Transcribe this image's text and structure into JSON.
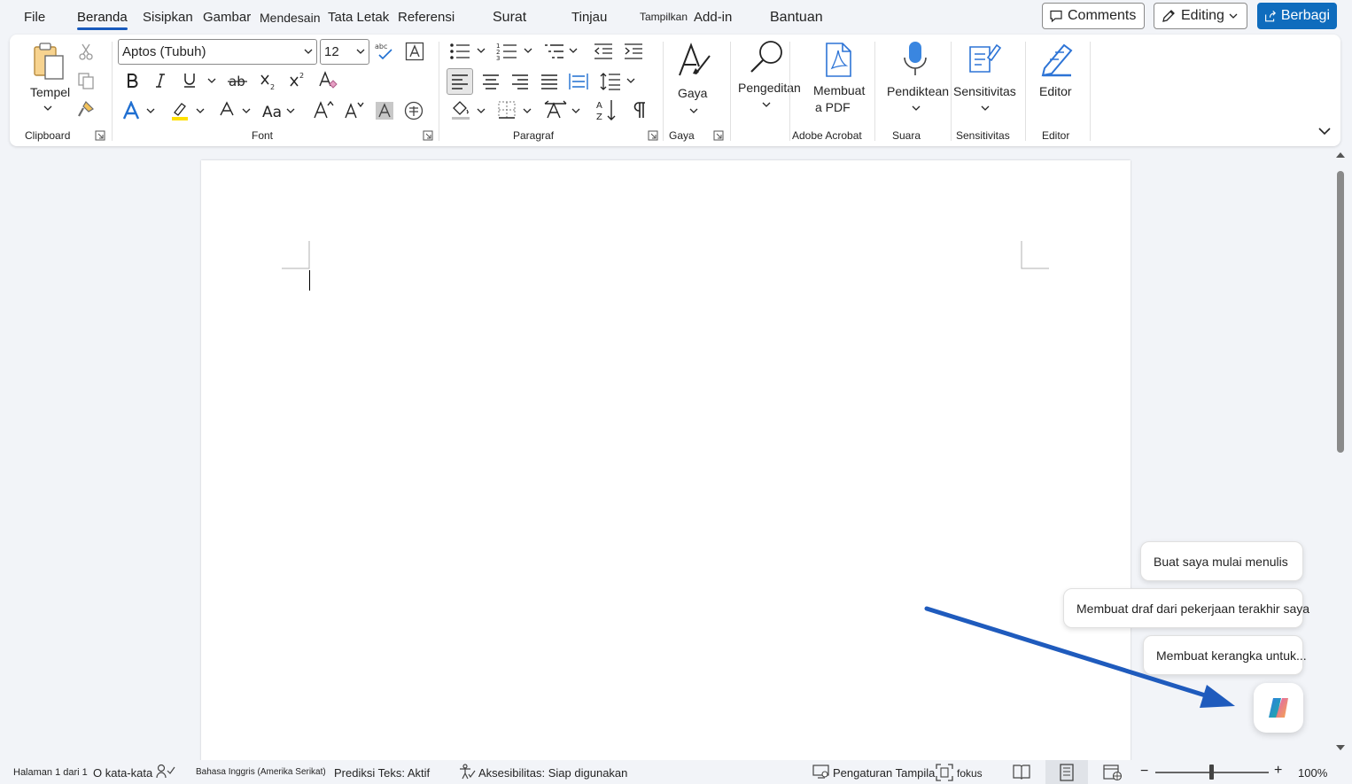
{
  "tabs": [
    {
      "label": "File"
    },
    {
      "label": "Beranda"
    },
    {
      "label": "Sisipkan"
    },
    {
      "label": "Gambar"
    },
    {
      "label": "Mendesain"
    },
    {
      "label": "Tata Letak"
    },
    {
      "label": "Referensi"
    },
    {
      "label": "Surat"
    },
    {
      "label": "Tinjau"
    },
    {
      "label": "Tampilkan"
    },
    {
      "label": "Add-in"
    },
    {
      "label": "Bantuan"
    }
  ],
  "header": {
    "comments_label": "Comments",
    "editing_label": "Editing",
    "share_label": "Berbagi"
  },
  "ribbon": {
    "clipboard": {
      "paste_label": "Tempel",
      "group_label": "Clipboard"
    },
    "font": {
      "font_name": "Aptos (Tubuh)",
      "font_size": "12",
      "group_label": "Font"
    },
    "paragraph": {
      "group_label": "Paragraf"
    },
    "styles": {
      "button_label": "Gaya",
      "group_label": "Gaya"
    },
    "editing": {
      "button_label": "Pengeditan"
    },
    "acrobat": {
      "button_label_line1": "Membuat",
      "button_label_line2": "a PDF",
      "group_label": "Adobe Acrobat"
    },
    "voice": {
      "button_label": "Pendiktean",
      "group_label": "Suara"
    },
    "sensitivity": {
      "button_label": "Sensitivitas",
      "group_label": "Sensitivitas"
    },
    "editor": {
      "button_label": "Editor",
      "group_label": "Editor"
    }
  },
  "copilot": {
    "suggestions": [
      "Buat saya mulai menulis",
      "Membuat draf dari pekerjaan terakhir saya",
      "Membuat kerangka untuk..."
    ]
  },
  "status": {
    "page": "Halaman 1 dari 1",
    "words": "O kata-kata",
    "language": "Bahasa Inggris (Amerika Serikat)",
    "prediction": "Prediksi Teks: Aktif",
    "accessibility": "Aksesibilitas: Siap digunakan",
    "display_settings": "Pengaturan Tampilan",
    "focus": "fokus",
    "zoom": "100%"
  },
  "colors": {
    "accent": "#185abd",
    "share_button": "#0f6cbd",
    "arrow": "#1f5bbd"
  }
}
